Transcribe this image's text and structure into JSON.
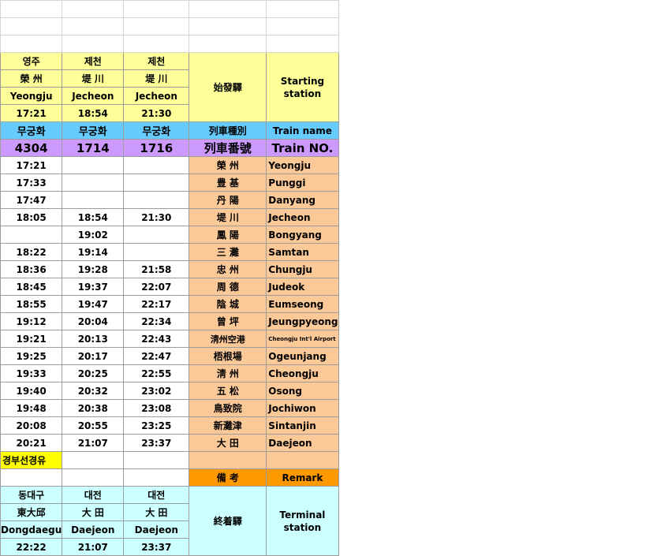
{
  "start": {
    "korean": [
      "영주",
      "제천",
      "제천"
    ],
    "hanja": [
      "榮 州",
      "堤 川",
      "堤 川"
    ],
    "roman": [
      "Yeongju",
      "Jecheon",
      "Jecheon"
    ],
    "time": [
      "17:21",
      "18:54",
      "21:30"
    ],
    "label_hanja": "始發驛",
    "label_en": "Starting station"
  },
  "train_name": {
    "values": [
      "무궁화",
      "무궁화",
      "무궁화"
    ],
    "label_hanja": "列車種別",
    "label_en": "Train name"
  },
  "train_no": {
    "values": [
      "4304",
      "1714",
      "1716"
    ],
    "label_hanja": "列車番號",
    "label_en": "Train NO."
  },
  "stations": [
    {
      "t1": "17:21",
      "t2": "",
      "t3": "",
      "hanja": "榮 州",
      "en": "Yeongju"
    },
    {
      "t1": "17:33",
      "t2": "",
      "t3": "",
      "hanja": "豊 基",
      "en": "Punggi"
    },
    {
      "t1": "17:47",
      "t2": "",
      "t3": "",
      "hanja": "丹 陽",
      "en": "Danyang"
    },
    {
      "t1": "18:05",
      "t2": "18:54",
      "t3": "21:30",
      "hanja": "堤 川",
      "en": "Jecheon"
    },
    {
      "t1": "",
      "t2": "19:02",
      "t3": "",
      "hanja": "鳳 陽",
      "en": "Bongyang"
    },
    {
      "t1": "18:22",
      "t2": "19:14",
      "t3": "",
      "hanja": "三 灘",
      "en": "Samtan"
    },
    {
      "t1": "18:36",
      "t2": "19:28",
      "t3": "21:58",
      "hanja": "忠 州",
      "en": "Chungju"
    },
    {
      "t1": "18:45",
      "t2": "19:37",
      "t3": "22:07",
      "hanja": "周 德",
      "en": "Judeok"
    },
    {
      "t1": "18:55",
      "t2": "19:47",
      "t3": "22:17",
      "hanja": "陰 城",
      "en": "Eumseong"
    },
    {
      "t1": "19:12",
      "t2": "20:04",
      "t3": "22:34",
      "hanja": "曾 坪",
      "en": "Jeungpyeong"
    },
    {
      "t1": "19:21",
      "t2": "20:13",
      "t3": "22:43",
      "hanja": "淸州空港",
      "en": "Cheongju Int'l Airport"
    },
    {
      "t1": "19:25",
      "t2": "20:17",
      "t3": "22:47",
      "hanja": "梧根場",
      "en": "Ogeunjang"
    },
    {
      "t1": "19:33",
      "t2": "20:25",
      "t3": "22:55",
      "hanja": "淸 州",
      "en": "Cheongju"
    },
    {
      "t1": "19:40",
      "t2": "20:32",
      "t3": "23:02",
      "hanja": "五 松",
      "en": "Osong"
    },
    {
      "t1": "19:48",
      "t2": "20:38",
      "t3": "23:08",
      "hanja": "鳥致院",
      "en": "Jochiwon"
    },
    {
      "t1": "20:08",
      "t2": "20:55",
      "t3": "23:25",
      "hanja": "新灘津",
      "en": "Sintanjin"
    },
    {
      "t1": "20:21",
      "t2": "21:07",
      "t3": "23:37",
      "hanja": "大 田",
      "en": "Daejeon"
    }
  ],
  "via_note": "경부선경유",
  "remark": {
    "label_hanja": "備 考",
    "label_en": "Remark"
  },
  "terminal": {
    "korean": [
      "동대구",
      "대전",
      "대전"
    ],
    "hanja": [
      "東大邱",
      "大 田",
      "大 田"
    ],
    "roman": [
      "Dongdaegu",
      "Daejeon",
      "Daejeon"
    ],
    "time": [
      "22:22",
      "21:07",
      "23:37"
    ],
    "label_hanja": "終着驛",
    "label_en": "Terminal station"
  },
  "colors": {
    "yellow": "#ffff99",
    "blue": "#66ccff",
    "purple": "#cc99ff",
    "peach": "#fbc898",
    "orange": "#ff9900",
    "cyan": "#ccffff",
    "bright_yellow": "#ffff00",
    "gridline": "#d4d4d4"
  }
}
